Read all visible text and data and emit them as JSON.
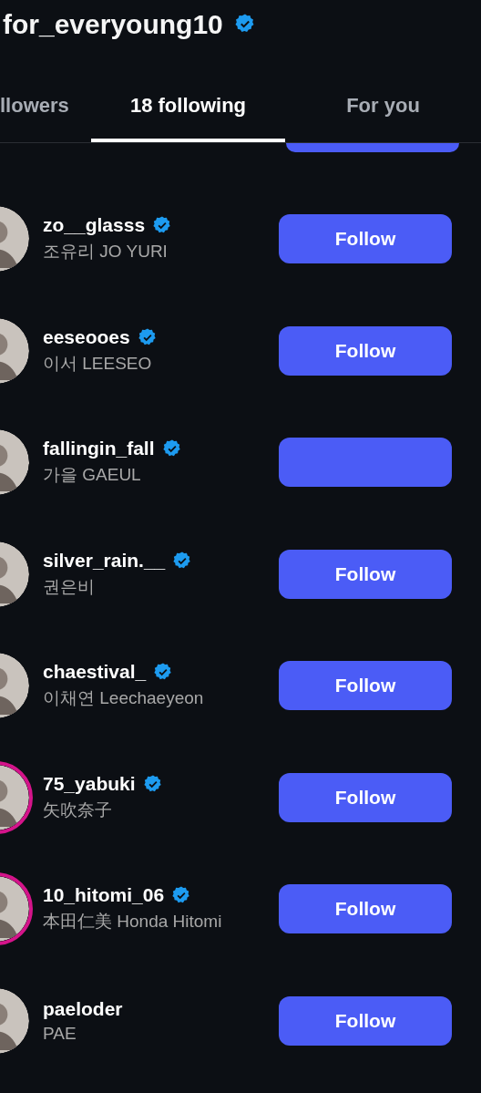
{
  "header": {
    "title": "for_everyoung10",
    "verified": true
  },
  "tabs": [
    {
      "label": "llowers",
      "selected": false
    },
    {
      "label": "18 following",
      "selected": true
    },
    {
      "label": "For you",
      "selected": false
    }
  ],
  "accounts": [
    {
      "username": "zo__glasss",
      "verified": true,
      "name": "조유리 JO YURI",
      "story_ring": false,
      "button": "Follow"
    },
    {
      "username": "eeseooes",
      "verified": true,
      "name": "이서 LEESEO",
      "story_ring": false,
      "button": "Follow"
    },
    {
      "username": "fallingin_fall",
      "verified": true,
      "name": "가을 GAEUL",
      "story_ring": false
    },
    {
      "username": "silver_rain.__",
      "verified": true,
      "name": "권은비",
      "story_ring": false,
      "button": "Follow"
    },
    {
      "username": "chaestival_",
      "verified": true,
      "name": "이채연 Leechaeyeon",
      "story_ring": false,
      "button": "Follow"
    },
    {
      "username": "75_yabuki",
      "verified": true,
      "name": "矢吹奈子",
      "story_ring": true,
      "button": "Follow"
    },
    {
      "username": "10_hitomi_06",
      "verified": true,
      "name": "本田仁美 Honda Hitomi",
      "story_ring": true,
      "button": "Follow"
    },
    {
      "username": "paeloder",
      "name": "PAE",
      "story_ring": false,
      "button": "Follow"
    }
  ]
}
